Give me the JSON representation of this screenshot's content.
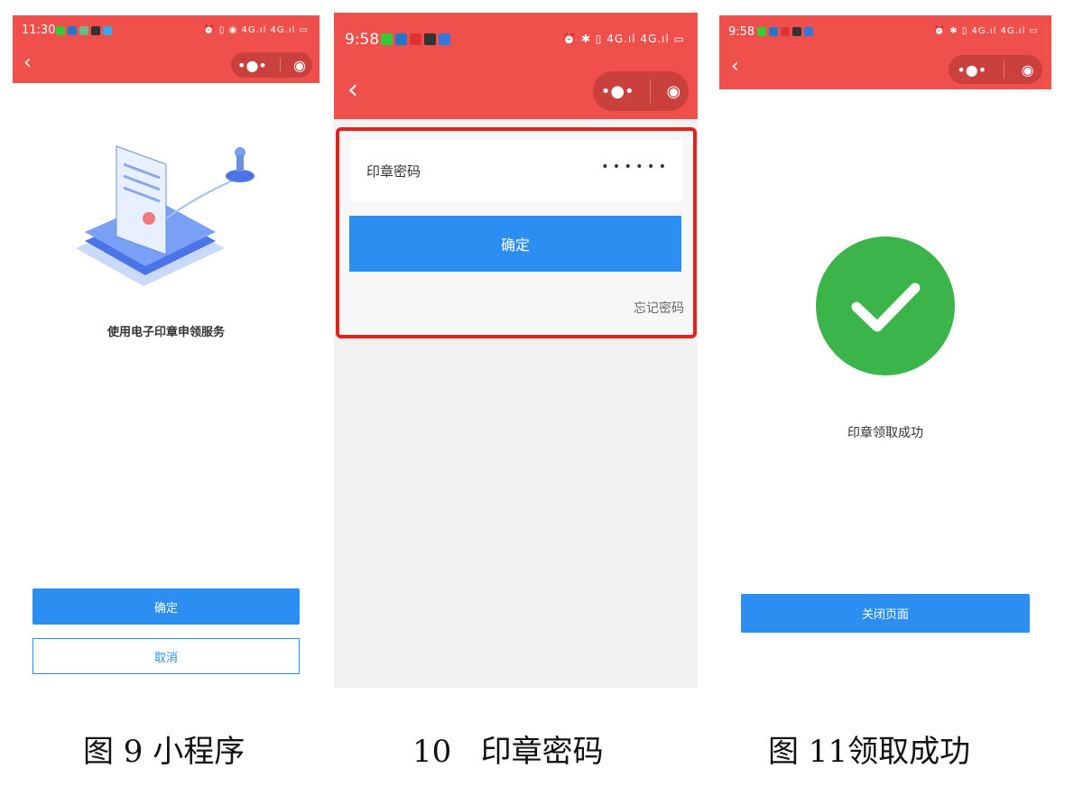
{
  "panel1": {
    "time": "11:30",
    "status_right": "⏰ ▯ ◉ 4G.ıl 4G.ıl ▭",
    "message": "使用电子印章申领服务",
    "confirm": "确定",
    "cancel": "取消",
    "caption": "图 9  小程序"
  },
  "panel2": {
    "time": "9:58",
    "status_right": "⏰ ✱ ▯ 4G.ıl 4G.ıl ▭",
    "field_label": "印章密码",
    "field_value": "• • • • • •",
    "confirm": "确定",
    "forgot": "忘记密码",
    "caption": "10   印章密码"
  },
  "panel3": {
    "time": "9:58",
    "status_right": "⏰ ✱ ▯ 4G.ıl 4G.ıl ▭",
    "message": "印章领取成功",
    "close": "关闭页面",
    "caption": "图 11领取成功"
  },
  "colors": {
    "header": "#f0504c",
    "primary": "#2b8ef0",
    "success": "#3bb54a",
    "highlight": "#e8201a"
  }
}
